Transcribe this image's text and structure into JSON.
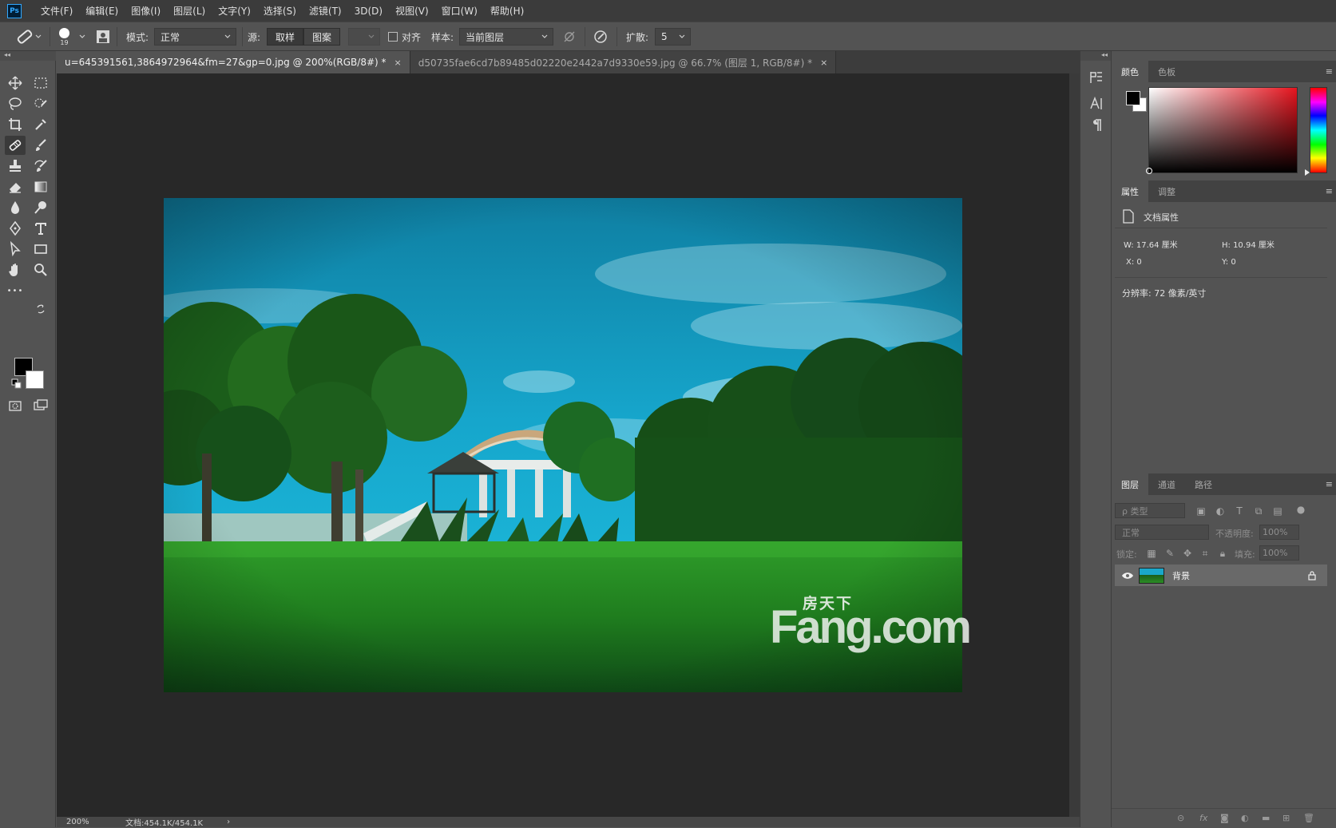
{
  "app": {
    "logo_text": "Ps"
  },
  "menu": [
    "文件(F)",
    "编辑(E)",
    "图像(I)",
    "图层(L)",
    "文字(Y)",
    "选择(S)",
    "滤镜(T)",
    "3D(D)",
    "视图(V)",
    "窗口(W)",
    "帮助(H)"
  ],
  "options": {
    "brush_size": "19",
    "mode_label": "模式:",
    "mode_value": "正常",
    "source_label": "源:",
    "source_sampled": "取样",
    "source_pattern": "图案",
    "aligned_label": "对齐",
    "sample_label": "样本:",
    "sample_value": "当前图层",
    "diffusion_label": "扩散:",
    "diffusion_value": "5"
  },
  "tabs": [
    {
      "title": "u=645391561,3864972964&fm=27&gp=0.jpg @ 200%(RGB/8#) *",
      "close": "×",
      "active": true
    },
    {
      "title": "d50735fae6cd7b89485d02220e2442a7d9330e59.jpg @ 66.7% (图层 1, RGB/8#) *",
      "close": "×",
      "active": false
    }
  ],
  "canvas": {
    "watermark_cn": "房天下",
    "watermark_en": "Fang.com"
  },
  "status": {
    "zoom": "200%",
    "doc_size": "文档:454.1K/454.1K",
    "arrow": "›"
  },
  "toolbar": {
    "more_label": "•••"
  },
  "colors": {
    "foreground": "#000000",
    "background": "#ffffff"
  },
  "color_panel": {
    "tabs": [
      "颜色",
      "色板"
    ]
  },
  "properties_panel": {
    "tabs": [
      "属性",
      "调整"
    ],
    "title": "文档属性",
    "w": "W:  17.64 厘米",
    "h": "H:  10.94 厘米",
    "x": "X:  0",
    "y": "Y:  0",
    "resolution": "分辨率: 72 像素/英寸"
  },
  "layers_panel": {
    "tabs": [
      "图层",
      "通道",
      "路径"
    ],
    "filter_placeholder": "ρ 类型",
    "blend_mode": "正常",
    "opacity_label": "不透明度:",
    "opacity_value": "100%",
    "lock_label": "锁定:",
    "fill_label": "填充:",
    "fill_value": "100%",
    "layers": [
      {
        "name": "背景",
        "visible": true,
        "locked": true
      }
    ]
  }
}
